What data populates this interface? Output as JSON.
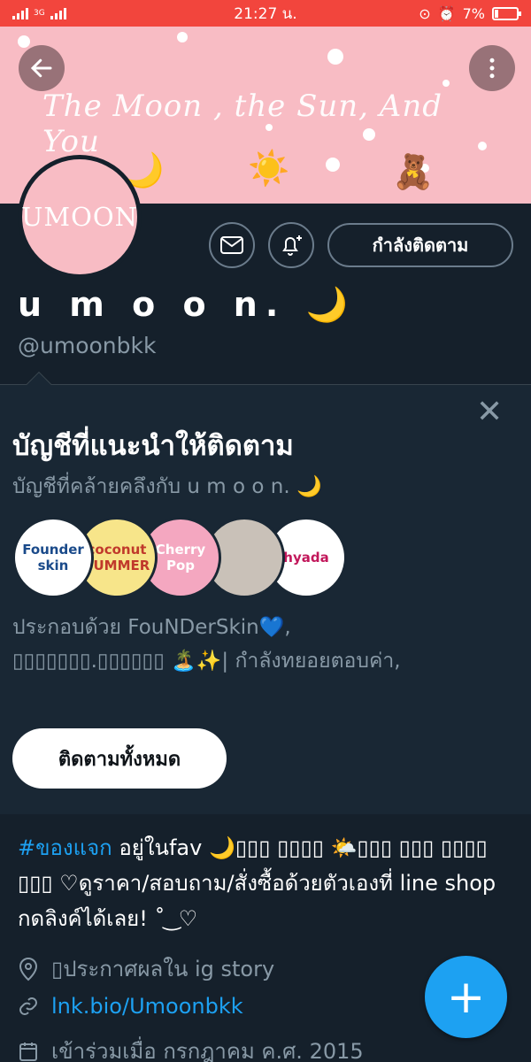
{
  "status_bar": {
    "time": "21:27 น.",
    "network": "3G",
    "battery": "7%"
  },
  "banner": {
    "script_text": "The Moon , the Sun, And You",
    "emojis": [
      "🌙",
      "☀️",
      "🧸"
    ],
    "back_icon": "arrow-left-icon",
    "more_icon": "more-vertical-icon",
    "background_color": "#f8bcc4"
  },
  "profile": {
    "avatar_text": "UMOON",
    "display_name": "u m o o n. 🌙",
    "handle": "@umoonbkk",
    "follow_button": "กำลังติดตาม",
    "message_icon": "envelope-icon",
    "notify_icon": "bell-plus-icon"
  },
  "suggestions": {
    "title": "บัญชีที่แนะนำให้ติดตาม",
    "subtitle": "บัญชีที่คล้ายคลึงกับ u m o o n. 🌙",
    "close_icon": "close-icon",
    "accounts": [
      {
        "label": "Founder skin",
        "bg": "#ffffff",
        "color": "#1a4a8a"
      },
      {
        "label": "coconut SUMMER",
        "bg": "#f7e58a",
        "color": "#c0392b"
      },
      {
        "label": "Cherry Pop",
        "bg": "#f4a7c0",
        "color": "#ffffff"
      },
      {
        "label": "",
        "bg": "#c9c1b8",
        "color": "#ffffff"
      },
      {
        "label": "hyada",
        "bg": "#ffffff",
        "color": "#c2185b"
      }
    ],
    "description_line1": "ประกอบด้วย FouNDerSkin💙,",
    "description_line2": "▯▯▯▯▯▯▯.▯▯▯▯▯▯ 🏝️✨| กำลังทยอยตอบค่า,",
    "follow_all": "ติดตามทั้งหมด"
  },
  "bio": {
    "hashtag": "#ของแจก",
    "text": " อยู่ในfav 🌙▯▯▯ ▯▯▯▯ 🌤️▯▯▯ ▯▯▯ ▯▯▯▯ ▯▯▯ ♡ดูราคา/สอบถาม/สั่งซื้อด้วยตัวเองที่ line shop กดลิงค์ได้เลย! ˚ ͜ ♡",
    "location": "▯ประกาศผลใน ig story",
    "link": "lnk.bio/Umoonbkk",
    "joined": "เข้าร่วมเมื่อ กรกฎาคม ค.ศ. 2015",
    "location_icon": "location-pin-icon",
    "link_icon": "link-icon",
    "calendar_icon": "calendar-icon"
  },
  "fab": {
    "label": "+",
    "icon": "compose-plus-icon"
  },
  "colors": {
    "accent": "#1da1f2",
    "background": "#15202b",
    "status_bar": "#f2453d"
  }
}
